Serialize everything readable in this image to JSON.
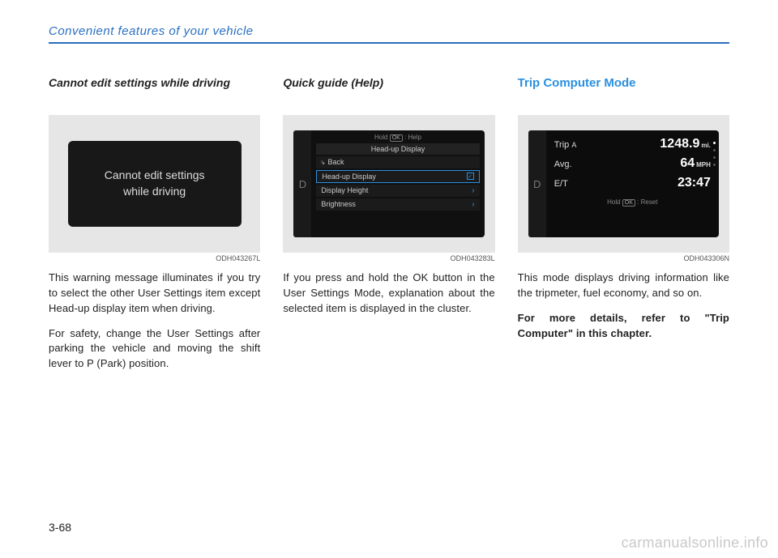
{
  "header": "Convenient features of your vehicle",
  "page_number": "3-68",
  "watermark": "carmanualsonline.info",
  "col1": {
    "heading": "Cannot edit settings while driving",
    "figure": {
      "warning_line1": "Cannot edit settings",
      "warning_line2": "while driving",
      "caption": "ODH043267L"
    },
    "p1": "This warning message illuminates if you try to select the other User Settings item except Head-up display item when driving.",
    "p2": "For safety, change the User Settings after parking the vehicle and moving the shift lever to P (Park) position."
  },
  "col2": {
    "heading": "Quick guide (Help)",
    "figure": {
      "gear": "D",
      "hold_prefix": "Hold",
      "hold_ok": "OK",
      "hold_suffix": ": Help",
      "title": "Head-up Display",
      "row_back": "Back",
      "row_hud": "Head-up Display",
      "row_height": "Display Height",
      "row_brightness": "Brightness",
      "caption": "ODH043283L"
    },
    "p1": "If you press and hold the OK button in the User Settings Mode, explanation about the selected item is displayed in the cluster."
  },
  "col3": {
    "heading": "Trip Computer Mode",
    "figure": {
      "gear": "D",
      "row_trip_label": "Trip",
      "row_trip_sub": "A",
      "row_trip_value": "1248.9",
      "row_trip_unit": "mi.",
      "row_avg_label": "Avg.",
      "row_avg_value": "64",
      "row_avg_unit": "MPH",
      "row_et_label": "E/T",
      "row_et_value": "23:47",
      "hold_prefix": "Hold",
      "hold_ok": "OK",
      "hold_suffix": ": Reset",
      "caption": "ODH043306N"
    },
    "p1": "This mode displays driving information like the tripmeter, fuel economy, and so on.",
    "p2": "For more details, refer to \"Trip Computer\" in this chapter."
  }
}
